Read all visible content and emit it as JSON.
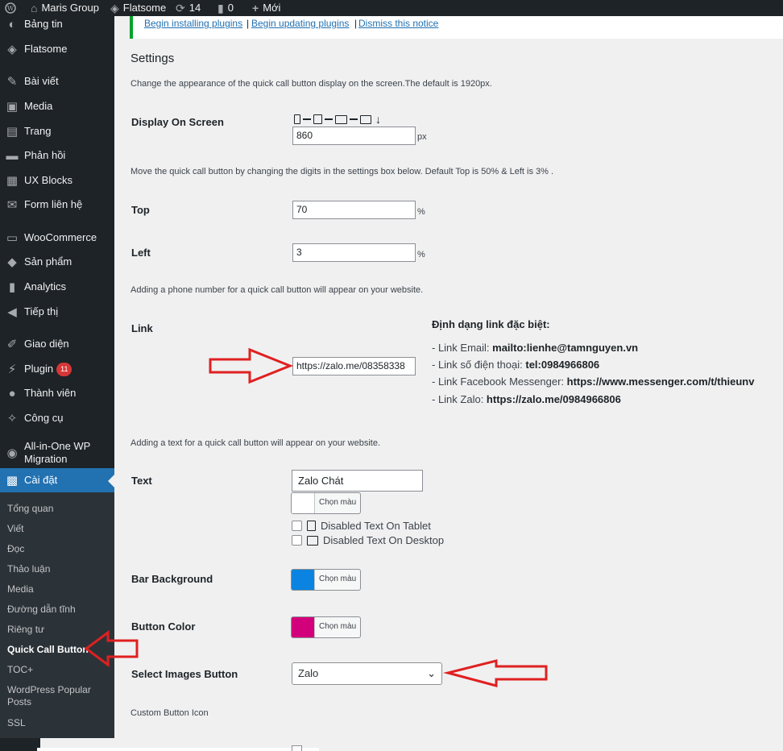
{
  "admin_bar": {
    "site_name": "Maris Group",
    "theme_name": "Flatsome",
    "updates_count": "14",
    "comments_count": "0",
    "new_label": "Mới"
  },
  "sidebar": {
    "items": [
      {
        "label": "Bảng tin",
        "icon": "dashboard-icon"
      },
      {
        "label": "Flatsome",
        "icon": "flatsome-icon"
      },
      {
        "label": "Bài viết",
        "icon": "pin-icon"
      },
      {
        "label": "Media",
        "icon": "media-icon"
      },
      {
        "label": "Trang",
        "icon": "page-icon"
      },
      {
        "label": "Phản hồi",
        "icon": "comment-icon"
      },
      {
        "label": "UX Blocks",
        "icon": "grid-icon"
      },
      {
        "label": "Form liên hệ",
        "icon": "mail-icon"
      },
      {
        "label": "WooCommerce",
        "icon": "woo-icon"
      },
      {
        "label": "Sản phẩm",
        "icon": "box-icon"
      },
      {
        "label": "Analytics",
        "icon": "bar-chart-icon"
      },
      {
        "label": "Tiếp thị",
        "icon": "megaphone-icon"
      },
      {
        "label": "Giao diện",
        "icon": "brush-icon"
      },
      {
        "label": "Plugin",
        "icon": "plugin-icon",
        "badge": "11"
      },
      {
        "label": "Thành viên",
        "icon": "user-icon"
      },
      {
        "label": "Công cụ",
        "icon": "wrench-icon"
      },
      {
        "label": "All-in-One WP Migration",
        "icon": "migration-icon"
      },
      {
        "label": "Cài đặt",
        "icon": "settings-icon"
      }
    ],
    "submenu": [
      "Tổng quan",
      "Viết",
      "Đọc",
      "Thảo luận",
      "Media",
      "Đường dẫn tĩnh",
      "Riêng tư",
      "Quick Call Button",
      "TOC+",
      "WordPress Popular Posts",
      "SSL"
    ]
  },
  "notice": {
    "links": [
      "Begin installing plugins",
      "Begin updating plugins",
      "Dismiss this notice"
    ],
    "separator": "|"
  },
  "settings": {
    "heading": "Settings",
    "display_desc": "Change the appearance of the quick call button display on the screen.The default is 1920px.",
    "display_label": "Display On Screen",
    "display_value": "860",
    "display_unit": "px",
    "position_desc": "Move the quick call button by changing the digits in the settings box below. Default Top is 50% & Left is 3% .",
    "top_label": "Top",
    "top_value": "70",
    "left_label": "Left",
    "left_value": "3",
    "percent_unit": "%",
    "phone_desc": "Adding a phone number for a quick call button will appear on your website.",
    "link_label": "Link",
    "link_value": "https://zalo.me/08358338",
    "help_title": "Định dạng link đặc biệt:",
    "help_lines": [
      {
        "prefix": "- Link Email: ",
        "value": "mailto:lienhe@tamnguyen.vn"
      },
      {
        "prefix": "- Link số điện thoại: ",
        "value": "tel:0984966806"
      },
      {
        "prefix": "- Link Facebook Messenger: ",
        "value": "https://www.messenger.com/t/thieunv"
      },
      {
        "prefix": "- Link Zalo: ",
        "value": "https://zalo.me/0984966806"
      }
    ],
    "text_desc": "Adding a text for a quick call button will appear on your website.",
    "text_label": "Text",
    "text_value": "Zalo Chát",
    "color_button_label": "Chọn màu",
    "disable_tablet_label": "Disabled Text On Tablet",
    "disable_desktop_label": "Disabled Text On Desktop",
    "bar_bg_label": "Bar Background",
    "bar_bg_color": "#0a84e0",
    "button_color_label": "Button Color",
    "button_color": "#d2007a",
    "text_color": "#ffffff",
    "select_images_label": "Select Images Button",
    "select_images_value": "Zalo",
    "custom_icon_label": "Custom Button Icon"
  },
  "colors": {
    "admin_dark": "#1d2327",
    "wp_blue": "#2271b1",
    "annotation_red": "#e02020"
  }
}
